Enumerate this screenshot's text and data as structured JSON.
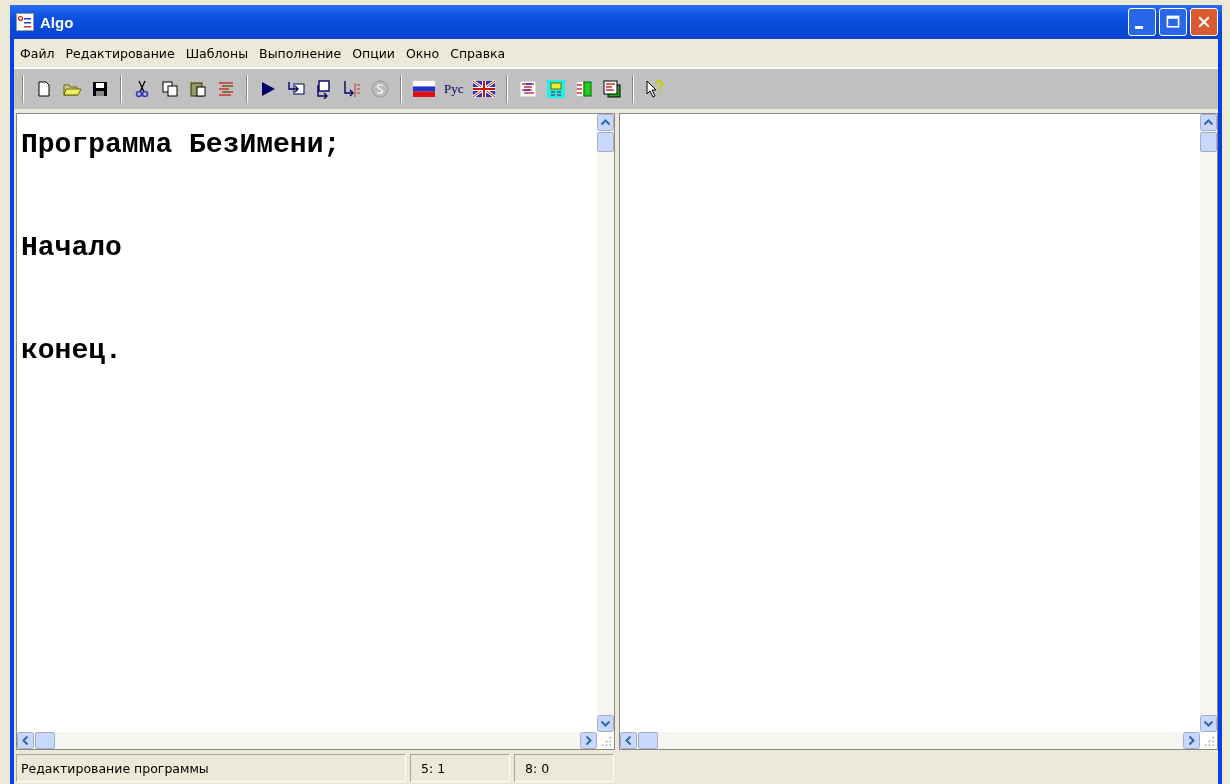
{
  "window": {
    "title": "Algo"
  },
  "menu": [
    "Файл",
    "Редактирование",
    "Шаблоны",
    "Выполнение",
    "Опции",
    "Окно",
    "Справка"
  ],
  "toolbar": {
    "language_label": "Рус"
  },
  "editor": {
    "lines": [
      "Программа БезИмени;",
      "Начало",
      "конец."
    ]
  },
  "status_bar": {
    "message": "Редактирование программы",
    "cursor": "5: 1",
    "size": "8: 0"
  }
}
